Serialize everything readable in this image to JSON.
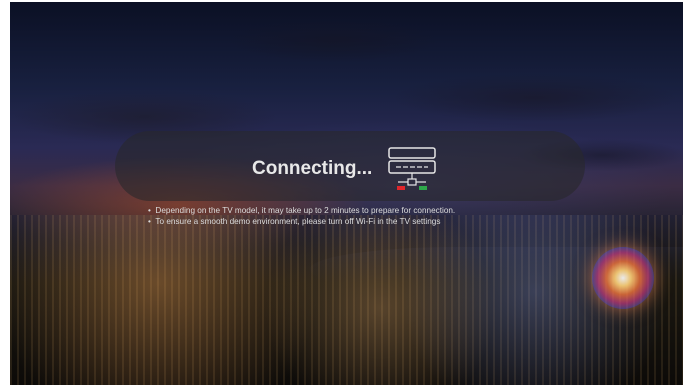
{
  "dialog": {
    "title": "Connecting...",
    "notes": [
      "Depending on the TV model, it may take up to 2 minutes to prepare for connection.",
      "To ensure a smooth demo environment, please turn off Wi-Fi in the TV settings"
    ],
    "icon": "tv-connection-icon",
    "indicator_colors": [
      "#e0262b",
      "#2ea84a"
    ]
  }
}
